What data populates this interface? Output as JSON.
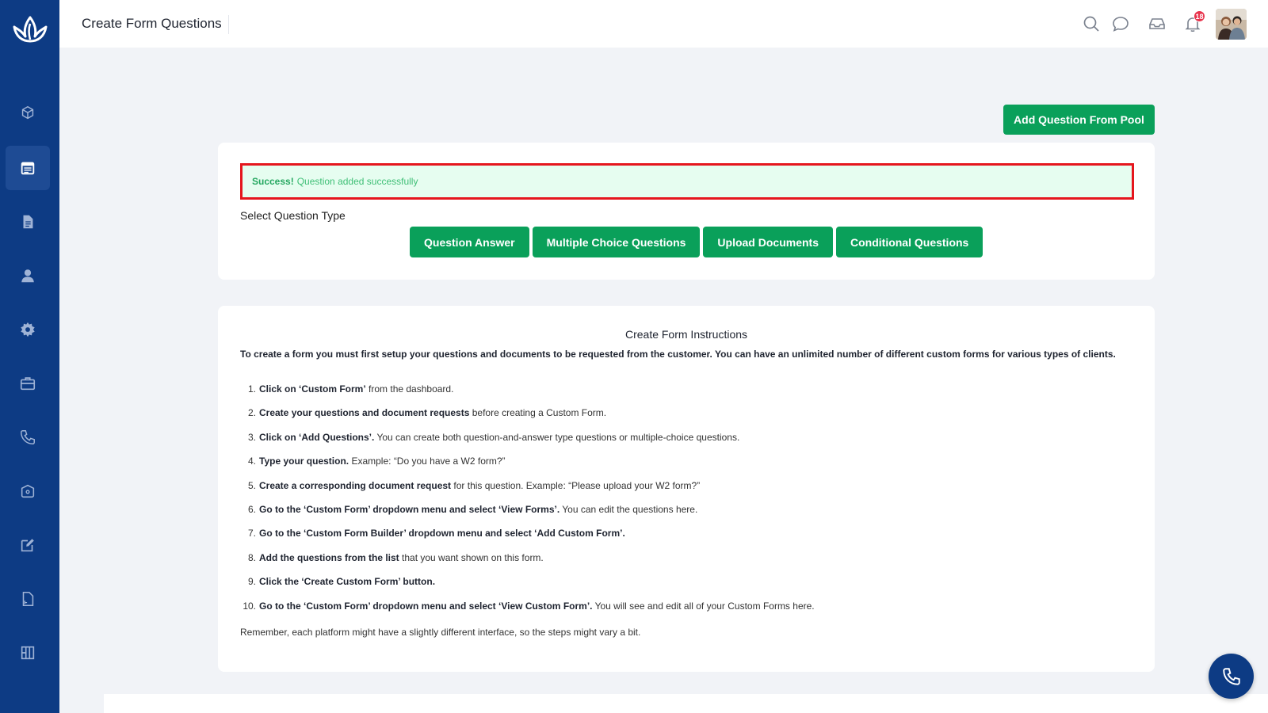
{
  "header": {
    "title": "Create Form Questions",
    "notification_count": "18"
  },
  "sidebar": {
    "items": [
      {
        "icon": "cube-network-icon"
      },
      {
        "icon": "calendar-icon",
        "active": true
      },
      {
        "icon": "document-icon"
      },
      {
        "icon": "user-icon"
      },
      {
        "icon": "gear-icon"
      },
      {
        "icon": "briefcase-icon"
      },
      {
        "icon": "phone-icon"
      },
      {
        "icon": "box-icon"
      },
      {
        "icon": "edit-icon"
      },
      {
        "icon": "pdf-icon"
      },
      {
        "icon": "grid-icon"
      }
    ]
  },
  "actions": {
    "pool_button": "Add Question From Pool"
  },
  "alert": {
    "strong": "Success!",
    "message": "Question added successfully"
  },
  "question_type": {
    "label": "Select Question Type",
    "buttons": [
      "Question Answer",
      "Multiple Choice Questions",
      "Upload Documents",
      "Conditional Questions"
    ]
  },
  "instructions": {
    "title": "Create Form Instructions",
    "intro": "To create a form you must first setup your questions and documents to be requested from the customer. You can have an unlimited number of different custom forms for various types of clients.",
    "steps": [
      {
        "num": "1.",
        "bold": "Click on ‘Custom Form’",
        "rest": " from the dashboard."
      },
      {
        "num": "2.",
        "bold": "Create your questions and document requests",
        "rest": " before creating a Custom Form."
      },
      {
        "num": "3.",
        "bold": "Click on ‘Add Questions’.",
        "rest": " You can create both question-and-answer type questions or multiple-choice questions."
      },
      {
        "num": "4.",
        "bold": "Type your question.",
        "rest": " Example: “Do you have a W2 form?”"
      },
      {
        "num": "5.",
        "bold": "Create a corresponding document request",
        "rest": " for this question. Example: “Please upload your W2 form?”"
      },
      {
        "num": "6.",
        "bold": "Go to the ‘Custom Form’ dropdown menu and select ‘View Forms’.",
        "rest": " You can edit the questions here."
      },
      {
        "num": "7.",
        "bold": "Go to the ‘Custom Form Builder’ dropdown menu and select ‘Add Custom Form’.",
        "rest": ""
      },
      {
        "num": "8.",
        "bold": "Add the questions from the list",
        "rest": " that you want shown on this form."
      },
      {
        "num": "9.",
        "bold": "Click the ‘Create Custom Form’ button.",
        "rest": ""
      },
      {
        "num": "10.",
        "bold": "Go to the ‘Custom Form’ dropdown menu and select ‘View Custom Form’.",
        "rest": " You will see and edit all of your Custom Forms here."
      }
    ],
    "footer": "Remember, each platform might have a slightly different interface, so the steps might vary a bit."
  },
  "colors": {
    "sidebar": "#0d3b84",
    "primary_button": "#0aa05a",
    "alert_border": "#e5161d",
    "alert_bg": "#e6fdf0"
  }
}
